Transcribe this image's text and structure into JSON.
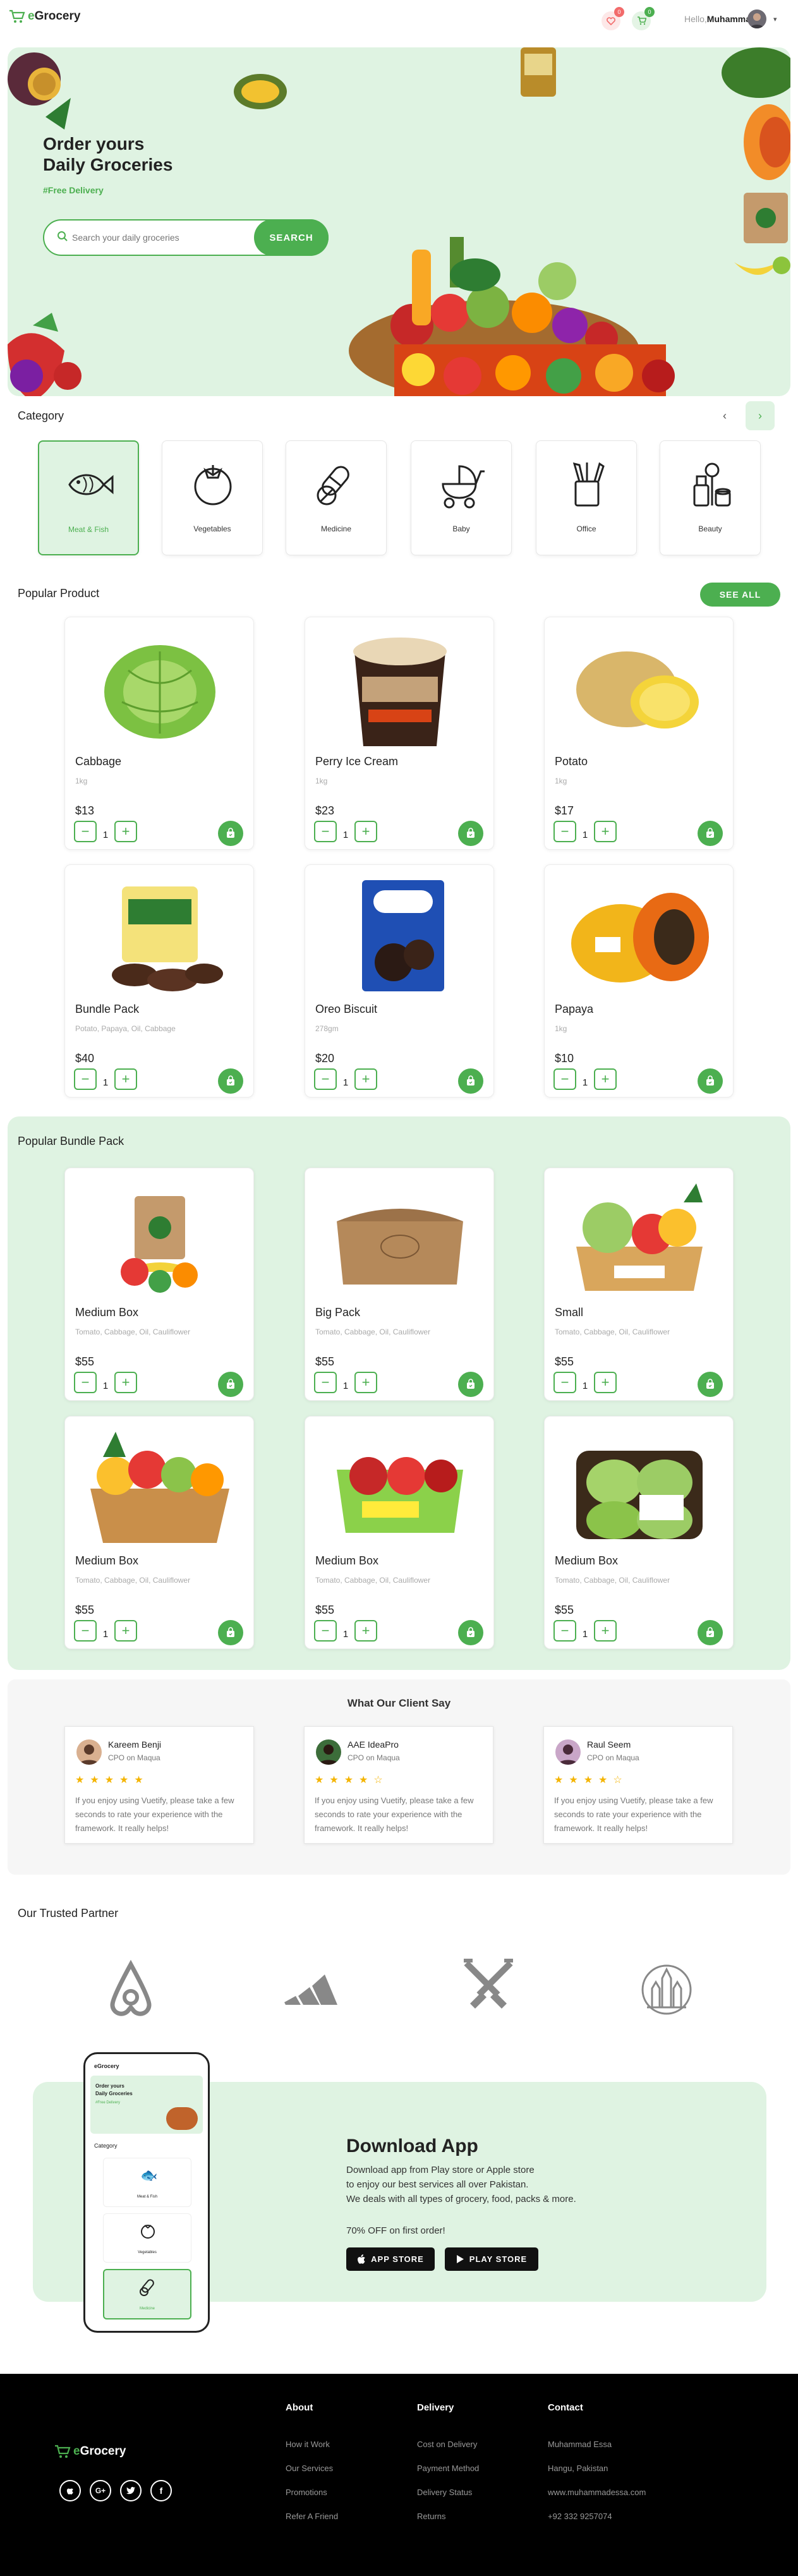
{
  "header": {
    "logo_prefix": "e",
    "logo_text": "Grocery",
    "wishlist_count": "0",
    "cart_count": "0",
    "hello_prefix": "Hello,",
    "user_name": "Muhammad!"
  },
  "hero": {
    "title_line1": "Order yours",
    "title_line2": "Daily Groceries",
    "tagline": "#Free Delivery",
    "search_placeholder": "Search your daily groceries",
    "search_button": "SEARCH"
  },
  "category": {
    "title": "Category",
    "items": [
      {
        "label": "Meat & Fish",
        "icon": "fish-icon"
      },
      {
        "label": "Vegetables",
        "icon": "tomato-icon"
      },
      {
        "label": "Medicine",
        "icon": "pills-icon"
      },
      {
        "label": "Baby",
        "icon": "stroller-icon"
      },
      {
        "label": "Office",
        "icon": "pencil-cup-icon"
      },
      {
        "label": "Beauty",
        "icon": "cosmetics-icon"
      }
    ]
  },
  "popular": {
    "title": "Popular Product",
    "see_all": "SEE ALL",
    "products": [
      {
        "name": "Cabbage",
        "desc": "1kg",
        "price": "$13",
        "qty": "1"
      },
      {
        "name": "Perry Ice Cream",
        "desc": "1kg",
        "price": "$23",
        "qty": "1"
      },
      {
        "name": "Potato",
        "desc": "1kg",
        "price": "$17",
        "qty": "1"
      },
      {
        "name": "Bundle Pack",
        "desc": "Potato, Papaya, Oil, Cabbage",
        "price": "$40",
        "qty": "1"
      },
      {
        "name": "Oreo Biscuit",
        "desc": "278gm",
        "price": "$20",
        "qty": "1"
      },
      {
        "name": "Papaya",
        "desc": "1kg",
        "price": "$10",
        "qty": "1"
      }
    ]
  },
  "bundles": {
    "title": "Popular Bundle Pack",
    "items": [
      {
        "name": "Medium Box",
        "desc": "Tomato, Cabbage, Oil, Cauliflower",
        "price": "$55",
        "qty": "1"
      },
      {
        "name": "Big Pack",
        "desc": "Tomato, Cabbage, Oil, Cauliflower",
        "price": "$55",
        "qty": "1"
      },
      {
        "name": "Small",
        "desc": "Tomato, Cabbage, Oil, Cauliflower",
        "price": "$55",
        "qty": "1"
      },
      {
        "name": "Medium Box",
        "desc": "Tomato, Cabbage, Oil, Cauliflower",
        "price": "$55",
        "qty": "1"
      },
      {
        "name": "Medium Box",
        "desc": "Tomato, Cabbage, Oil, Cauliflower",
        "price": "$55",
        "qty": "1"
      },
      {
        "name": "Medium Box",
        "desc": "Tomato, Cabbage, Oil, Cauliflower",
        "price": "$55",
        "qty": "1"
      }
    ]
  },
  "testimonials": {
    "title": "What Our Client Say",
    "items": [
      {
        "name": "Kareem Benji",
        "role": "CPO on Maqua",
        "stars": "★★★★★",
        "text": "If you enjoy using Vuetify, please take a few seconds to rate your experience with the framework. It really helps!"
      },
      {
        "name": "AAE IdeaPro",
        "role": "CPO on Maqua",
        "stars": "★★★★☆",
        "text": "If you enjoy using Vuetify, please take a few seconds to rate your experience with the framework. It really helps!"
      },
      {
        "name": "Raul Seem",
        "role": "CPO on Maqua",
        "stars": "★★★★☆",
        "text": "If you enjoy using Vuetify, please take a few seconds to rate your experience with the framework. It really helps!"
      }
    ]
  },
  "partners": {
    "title": "Our Trusted Partner",
    "logos": [
      "airbnb-logo-icon",
      "adidas-logo-icon",
      "crossed-swords-logo-icon",
      "castle-logo-icon"
    ]
  },
  "download": {
    "title": "Download App",
    "line1": "Download app from Play store or Apple store",
    "line2": "to enjoy our best services all over Pakistan.",
    "line3": "We deals with all types of grocery, food, packs & more.",
    "offer": "70% OFF on first order!",
    "app_store": "APP STORE",
    "play_store": "PLAY STORE",
    "phone": {
      "logo": "eGrocery",
      "title1": "Order yours",
      "title2": "Daily Groceries",
      "tagline": "#Free Delivery",
      "category": "Category",
      "cat1": "Meat & Fish",
      "cat2": "Vegetables",
      "cat3": "Medicine"
    }
  },
  "footer": {
    "logo_prefix": "e",
    "logo_text": "Grocery",
    "about_title": "About",
    "about_links": [
      "How it Work",
      "Our Services",
      "Promotions",
      "Refer A Friend"
    ],
    "delivery_title": "Delivery",
    "delivery_links": [
      "Cost on Delivery",
      "Payment Method",
      "Delivery Status",
      "Returns"
    ],
    "contact_title": "Contact",
    "contact_lines": [
      "Muhammad Essa",
      "Hangu, Pakistan",
      "www.muhammadessa.com",
      "+92 332 9257074"
    ],
    "social": [
      "apple-icon",
      "google-plus-icon",
      "twitter-icon",
      "facebook-icon"
    ]
  },
  "colors": {
    "accent": "#4caf50",
    "hero_bg": "#dff3e2",
    "footer_bg": "#000000",
    "badge": "#f26b6b"
  }
}
